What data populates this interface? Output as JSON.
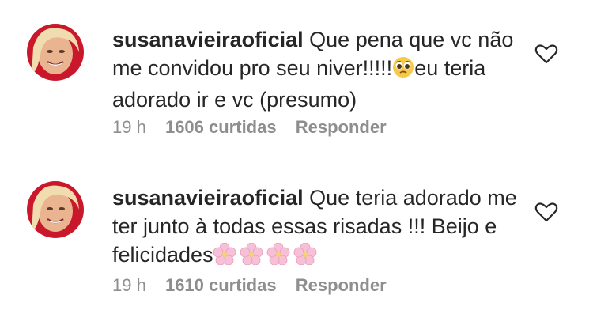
{
  "comments": [
    {
      "username": "susanavieiraoficial",
      "text_1": "Que pena que vc não me convidou pro seu niver!!!!!",
      "emoji_1": "pleading-face",
      "text_2": "eu teria adorado ir e vc (presumo)",
      "time": "19 h",
      "likes": "1606 curtidas",
      "reply": "Responder"
    },
    {
      "username": "susanavieiraoficial",
      "text_1": "Que teria adorado me ter junto à todas essas risadas !!! Beijo e felicidades",
      "emoji_1": "cherry-blossom",
      "time": "19 h",
      "likes": "1610 curtidas",
      "reply": "Responder"
    }
  ],
  "colors": {
    "text": "#262626",
    "meta": "#8e8e8e",
    "blossom": "#f6c1d6"
  }
}
